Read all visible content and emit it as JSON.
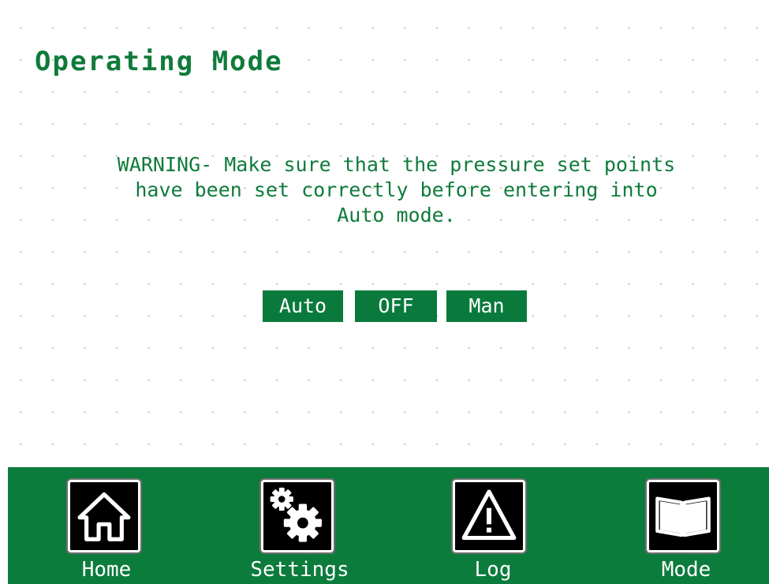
{
  "page": {
    "title": "Operating Mode",
    "warning": "WARNING- Make sure that the pressure set points\nhave been set correctly before entering into\nAuto mode."
  },
  "mode_buttons": {
    "auto": "Auto",
    "off": "OFF",
    "manual": "Man"
  },
  "nav": {
    "items": [
      {
        "label": "Home",
        "icon": "home-icon"
      },
      {
        "label": "Settings",
        "icon": "gears-icon"
      },
      {
        "label": "Log",
        "icon": "warning-triangle-icon"
      },
      {
        "label": "Mode",
        "icon": "book-icon"
      }
    ]
  },
  "colors": {
    "accent": "#0f7b3b",
    "button_bg": "#0a7a3c",
    "navbar_bg": "#0c7c3c",
    "text_light": "#ffffff",
    "icon_bg": "#000000"
  }
}
